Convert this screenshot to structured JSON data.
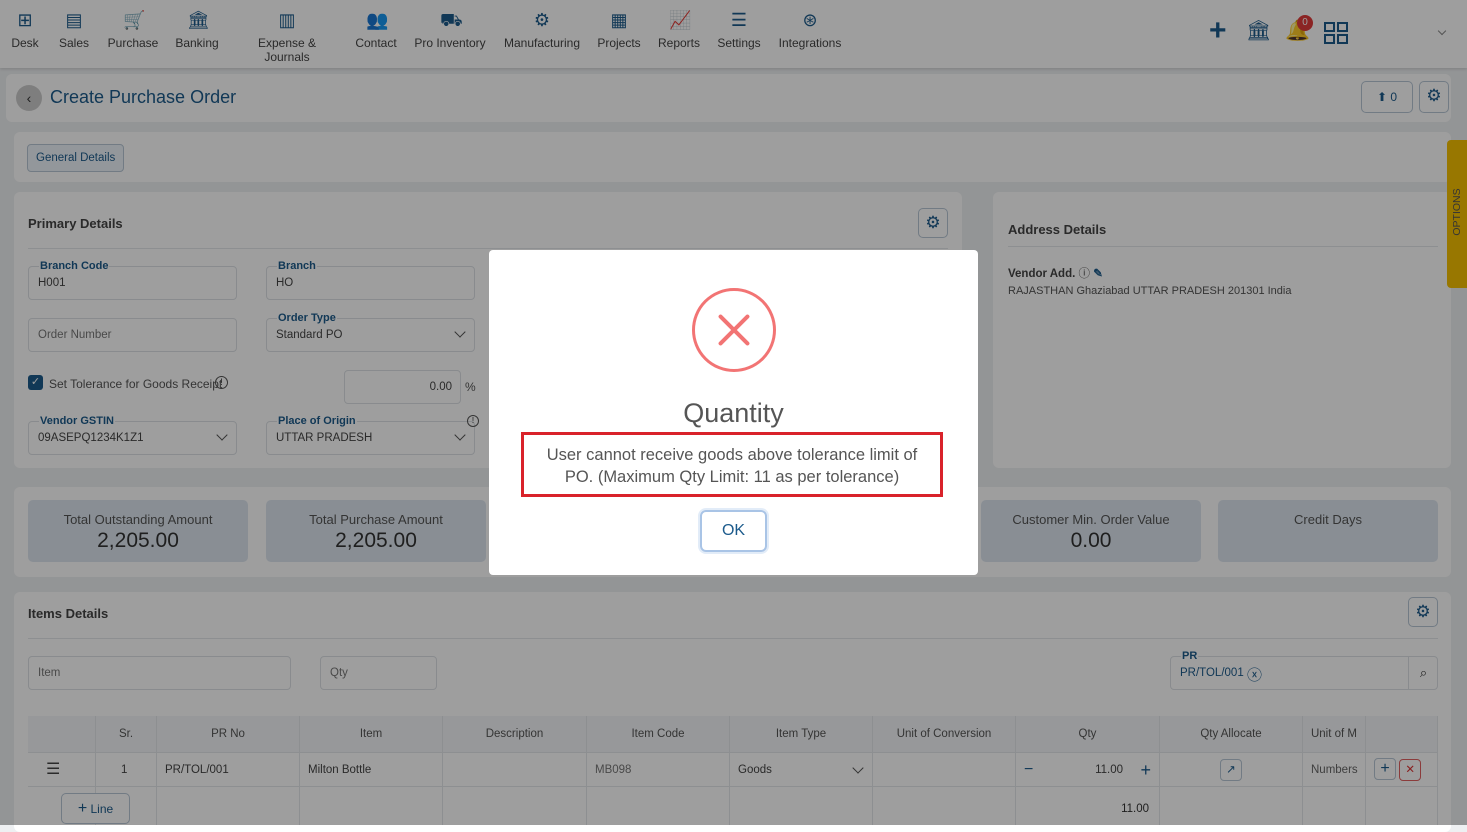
{
  "nav": {
    "items": [
      {
        "label": "Desk",
        "icon": "desk-icon",
        "glyph": "⊞"
      },
      {
        "label": "Sales",
        "icon": "sales-icon",
        "glyph": "▤"
      },
      {
        "label": "Purchase",
        "icon": "cart-icon",
        "glyph": "🛒"
      },
      {
        "label": "Banking",
        "icon": "bank-icon",
        "glyph": "🏛"
      },
      {
        "label": "Expense & Journals",
        "icon": "journal-icon",
        "glyph": "▥"
      },
      {
        "label": "Contact",
        "icon": "contact-icon",
        "glyph": "👥"
      },
      {
        "label": "Pro Inventory",
        "icon": "inventory-icon",
        "glyph": "⛟"
      },
      {
        "label": "Manufacturing",
        "icon": "manufacturing-icon",
        "glyph": "⚙"
      },
      {
        "label": "Projects",
        "icon": "projects-icon",
        "glyph": "▦"
      },
      {
        "label": "Reports",
        "icon": "reports-icon",
        "glyph": "📈"
      },
      {
        "label": "Settings",
        "icon": "settings-sliders-icon",
        "glyph": "☰"
      },
      {
        "label": "Integrations",
        "icon": "integrations-icon",
        "glyph": "⊛"
      }
    ],
    "notification_count": "0"
  },
  "header": {
    "title": "Create Purchase Order",
    "upload_count": "0"
  },
  "tabs": {
    "general": "General Details"
  },
  "primary": {
    "title": "Primary Details",
    "branch_code_label": "Branch Code",
    "branch_code": "H001",
    "branch_label": "Branch",
    "branch": "HO",
    "order_number_placeholder": "Order Number",
    "order_type_label": "Order Type",
    "order_type": "Standard PO",
    "tolerance_label": "Set Tolerance for Goods Receipt",
    "tolerance_checked": true,
    "tolerance_value": "0.00",
    "percent": "%",
    "vendor_gstin_label": "Vendor GSTIN",
    "vendor_gstin": "09ASEPQ1234K1Z1",
    "place_label": "Place of Origin",
    "place": "UTTAR PRADESH"
  },
  "address": {
    "title": "Address Details",
    "vendor_label": "Vendor Add.",
    "vendor_address": "RAJASTHAN Ghaziabad UTTAR PRADESH 201301 India"
  },
  "options_tab": "OPTIONS",
  "summary": [
    {
      "title": "Total Outstanding Amount",
      "value": "2,205.00"
    },
    {
      "title": "Total Purchase Amount",
      "value": "2,205.00"
    },
    {
      "title": "Customer Min. Order Value",
      "value": "0.00"
    },
    {
      "title": "Credit Days",
      "value": ""
    }
  ],
  "items": {
    "title": "Items Details",
    "item_placeholder": "Item",
    "qty_placeholder": "Qty",
    "pr_label": "PR",
    "pr_value": "PR/TOL/001",
    "columns": [
      "Sr.",
      "PR No",
      "Item",
      "Description",
      "Item Code",
      "Item Type",
      "Unit of Conversion",
      "Qty",
      "Qty Allocate",
      "Unit of M"
    ],
    "rows": [
      {
        "sr": "1",
        "pr_no": "PR/TOL/001",
        "item": "Milton Bottle",
        "description": "",
        "item_code": "MB098",
        "item_type": "Goods",
        "unit_conversion": "",
        "qty": "11.00",
        "unit": "Numbers"
      }
    ],
    "add_line": "Line",
    "total_qty": "11.00"
  },
  "modal": {
    "title": "Quantity",
    "message": "User cannot receive goods above tolerance limit of PO. (Maximum Qty Limit: 11 as per tolerance)",
    "ok": "OK",
    "error_color": "#e5484d"
  }
}
